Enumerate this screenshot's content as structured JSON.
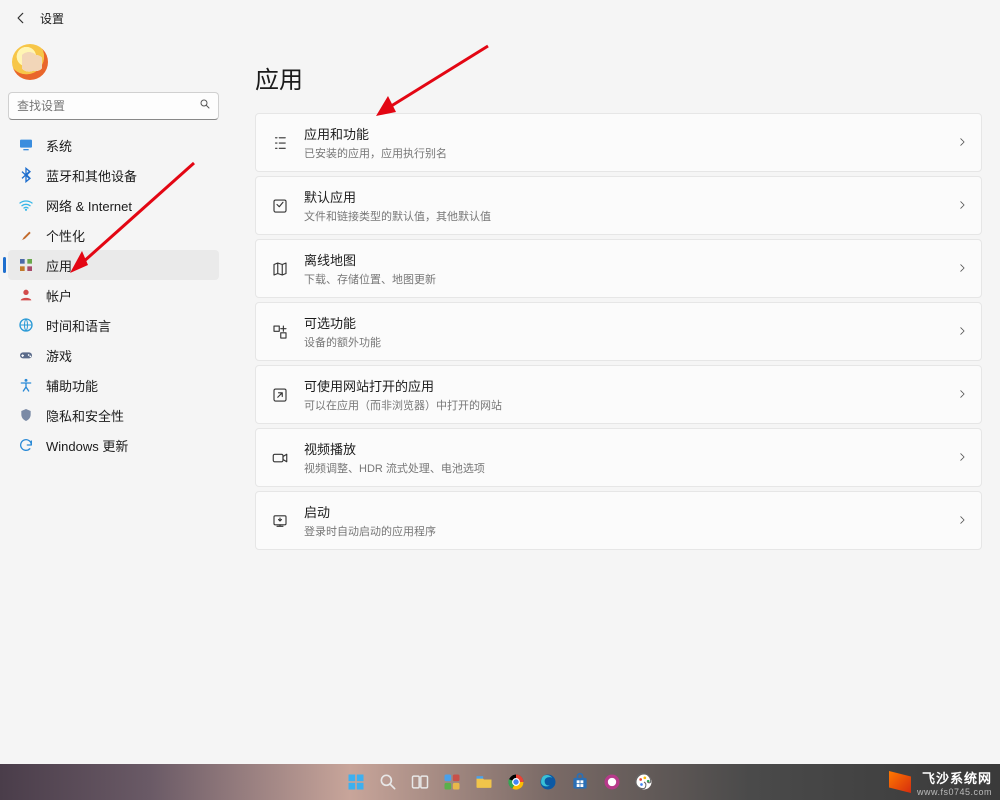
{
  "header": {
    "title": "设置"
  },
  "search": {
    "placeholder": "查找设置"
  },
  "sidebar": {
    "items": [
      {
        "name": "system",
        "label": "系统",
        "icon": "monitor",
        "color": "#3a8dde"
      },
      {
        "name": "bluetooth",
        "label": "蓝牙和其他设备",
        "icon": "bt",
        "color": "#1f6fce"
      },
      {
        "name": "network",
        "label": "网络 & Internet",
        "icon": "wifi",
        "color": "#35b7e8"
      },
      {
        "name": "personalize",
        "label": "个性化",
        "icon": "brush",
        "color": "#c26a2a"
      },
      {
        "name": "apps",
        "label": "应用",
        "icon": "apps",
        "color": "#4b5a7a",
        "active": true
      },
      {
        "name": "accounts",
        "label": "帐户",
        "icon": "person",
        "color": "#d24a4a"
      },
      {
        "name": "time",
        "label": "时间和语言",
        "icon": "globe",
        "color": "#2a9ad6"
      },
      {
        "name": "gaming",
        "label": "游戏",
        "icon": "gamepad",
        "color": "#5a6b8a"
      },
      {
        "name": "a11y",
        "label": "辅助功能",
        "icon": "access",
        "color": "#2a8ad6"
      },
      {
        "name": "privacy",
        "label": "隐私和安全性",
        "icon": "shield",
        "color": "#7a8aa6"
      },
      {
        "name": "update",
        "label": "Windows 更新",
        "icon": "refresh",
        "color": "#2a8ad6"
      }
    ]
  },
  "page": {
    "title": "应用",
    "items": [
      {
        "name": "apps-features",
        "title": "应用和功能",
        "desc": "已安装的应用，应用执行别名"
      },
      {
        "name": "default-apps",
        "title": "默认应用",
        "desc": "文件和链接类型的默认值，其他默认值"
      },
      {
        "name": "offline-maps",
        "title": "离线地图",
        "desc": "下载、存储位置、地图更新"
      },
      {
        "name": "optional",
        "title": "可选功能",
        "desc": "设备的额外功能"
      },
      {
        "name": "website-apps",
        "title": "可使用网站打开的应用",
        "desc": "可以在应用（而非浏览器）中打开的网站"
      },
      {
        "name": "video",
        "title": "视频播放",
        "desc": "视频调整、HDR 流式处理、电池选项"
      },
      {
        "name": "startup",
        "title": "启动",
        "desc": "登录时自动启动的应用程序"
      }
    ]
  },
  "watermark": {
    "title": "飞沙系统网",
    "url": "www.fs0745.com"
  },
  "taskbar": {
    "icons": [
      "start",
      "search",
      "taskview",
      "widgets",
      "explorer",
      "chrome",
      "edge",
      "store",
      "qq",
      "paint"
    ]
  }
}
